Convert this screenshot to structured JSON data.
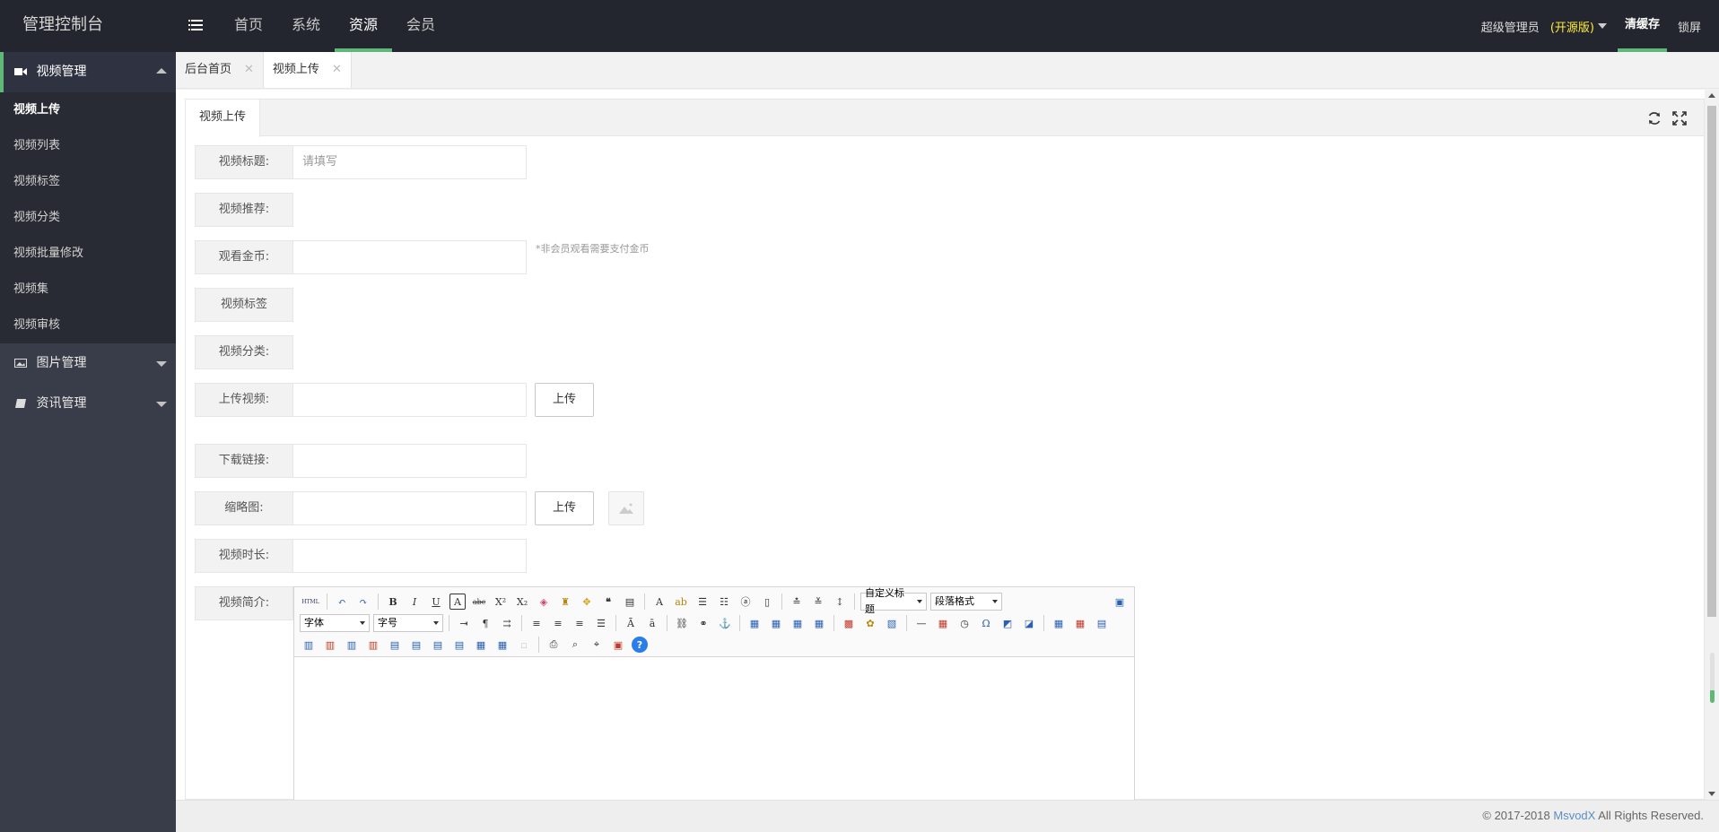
{
  "app": {
    "title": "管理控制台"
  },
  "topnav": {
    "items": [
      {
        "label": "首页"
      },
      {
        "label": "系统"
      },
      {
        "label": "资源"
      },
      {
        "label": "会员"
      }
    ]
  },
  "user": {
    "name": "超级管理员",
    "edition": "(开源版)",
    "clear_cache": "清缓存",
    "lock": "锁屏"
  },
  "sidebar": {
    "groups": [
      {
        "label": "视频管理",
        "icon": "video-camera-icon"
      },
      {
        "label": "图片管理",
        "icon": "image-icon"
      },
      {
        "label": "资讯管理",
        "icon": "book-icon"
      }
    ],
    "video_items": [
      {
        "label": "视频上传"
      },
      {
        "label": "视频列表"
      },
      {
        "label": "视频标签"
      },
      {
        "label": "视频分类"
      },
      {
        "label": "视频批量修改"
      },
      {
        "label": "视频集"
      },
      {
        "label": "视频审核"
      }
    ]
  },
  "tabs": [
    {
      "label": "后台首页"
    },
    {
      "label": "视频上传"
    }
  ],
  "panel": {
    "tab": "视频上传"
  },
  "form": {
    "title_label": "视频标题:",
    "title_placeholder": "请填写",
    "recommend_label": "视频推荐:",
    "gold_label": "观看金币:",
    "gold_hint": "*非会员观看需要支付金币",
    "tag_label": "视频标签",
    "category_label": "视频分类:",
    "upload_video_label": "上传视频:",
    "upload_button": "上传",
    "download_label": "下载链接:",
    "thumb_label": "缩略图:",
    "duration_label": "视频时长:",
    "intro_label": "视频简介:"
  },
  "editor": {
    "custom_title": "自定义标题",
    "paragraph": "段落格式",
    "font": "字体",
    "size": "字号"
  },
  "scroll_progress": 0.25,
  "footer": {
    "copyright": "© 2017-2018 ",
    "brand": "MsvodX",
    "rights": " All Rights Reserved."
  }
}
